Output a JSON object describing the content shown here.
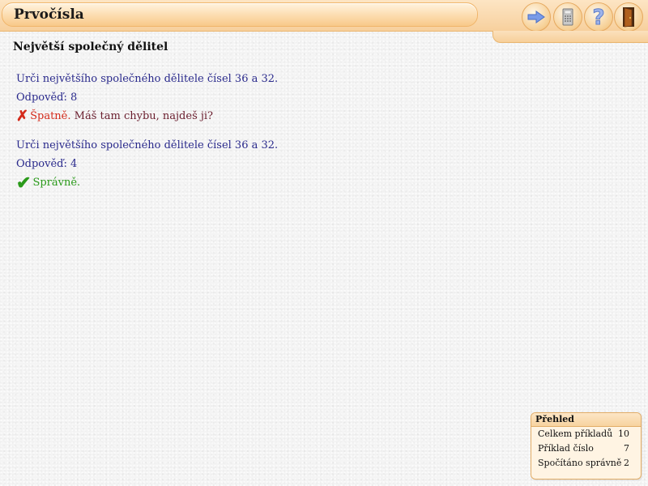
{
  "app": {
    "title": "Prvočísla"
  },
  "toolbar": {
    "icons": [
      "arrow-right-icon",
      "calculator-icon",
      "question-icon",
      "door-exit-icon"
    ]
  },
  "section": {
    "title": "Největší společný dělitel"
  },
  "exercises": [
    {
      "question": "Urči největšího společného dělitele čísel 36 a 32.",
      "answer_label": "Odpověď:",
      "answer_value": "8",
      "status": "Špatně.",
      "message": "Máš tam chybu, najdeš ji?",
      "correct": false
    },
    {
      "question": "Urči největšího společného dělitele čísel 36 a 32.",
      "answer_label": "Odpověď:",
      "answer_value": "4",
      "status": "Správně.",
      "message": "",
      "correct": true
    }
  ],
  "overview": {
    "title": "Přehled",
    "rows": [
      {
        "label": "Celkem příkladů",
        "value": "10"
      },
      {
        "label": "Příklad číslo",
        "value": "7"
      },
      {
        "label": "Spočítáno správně",
        "value": "2"
      }
    ]
  },
  "colors": {
    "accent": "#f7d09d",
    "question_text": "#2a2a8c",
    "wrong": "#d42a1a",
    "right": "#2a9a1a"
  }
}
